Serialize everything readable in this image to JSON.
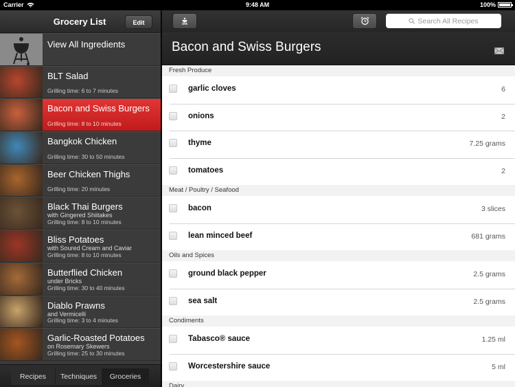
{
  "status_bar": {
    "carrier": "Carrier",
    "time": "9:48 AM",
    "battery": "100%",
    "battery_level": 1.0
  },
  "sidebar": {
    "title": "Grocery List",
    "edit_label": "Edit",
    "items": [
      {
        "title": "View All Ingredients",
        "subtitle": "",
        "time": "",
        "icon": "grill-icon",
        "color": "#8a8a8a"
      },
      {
        "title": "BLT Salad",
        "subtitle": "",
        "time": "Grilling time: 6 to 7 minutes",
        "color": "#b8452e"
      },
      {
        "title": "Bacon and Swiss Burgers",
        "subtitle": "",
        "time": "Grilling time: 8 to 10 minutes",
        "color": "#c9603d",
        "selected": true
      },
      {
        "title": "Bangkok Chicken",
        "subtitle": "",
        "time": "Grilling time: 30 to 50 minutes",
        "color": "#3f88b8"
      },
      {
        "title": "Beer Chicken Thighs",
        "subtitle": "",
        "time": "Grilling time: 20 minutes",
        "color": "#a9652c"
      },
      {
        "title": "Black Thai Burgers",
        "subtitle": "with Gingered Shiitakes",
        "time": "Grilling time: 8 to 10 minutes",
        "color": "#6b5236"
      },
      {
        "title": "Bliss Potatoes",
        "subtitle": "with Soured Cream and Caviar",
        "time": "Grilling time: 8 to 10 minutes",
        "color": "#9c3526"
      },
      {
        "title": "Butterflied Chicken",
        "subtitle": "under Bricks",
        "time": "Grilling time: 30 to 40 minutes",
        "color": "#a56a38"
      },
      {
        "title": "Diablo Prawns",
        "subtitle": "and Vermicelli",
        "time": "Grilling time: 3 to 4 minutes",
        "color": "#c8a36b"
      },
      {
        "title": "Garlic-Roasted Potatoes",
        "subtitle": "on Rosemary Skewers",
        "time": "Grilling time: 25 to 30 minutes",
        "color": "#a4561f"
      }
    ],
    "tabs": [
      {
        "label": "Recipes",
        "active": false
      },
      {
        "label": "Techniques",
        "active": false
      },
      {
        "label": "Groceries",
        "active": true
      }
    ]
  },
  "toolbar": {
    "grill_button_icon": "grill-icon",
    "timer_button_icon": "alarm-clock-icon",
    "search_placeholder": "Search All Recipes"
  },
  "recipe": {
    "title": "Bacon and Swiss Burgers",
    "sections": [
      {
        "name": "Fresh Produce",
        "items": [
          {
            "name": "garlic cloves",
            "qty": "6",
            "checked": false
          },
          {
            "name": "onions",
            "qty": "2",
            "checked": false
          },
          {
            "name": "thyme",
            "qty": "7.25 grams",
            "checked": false
          },
          {
            "name": "tomatoes",
            "qty": "2",
            "checked": false
          }
        ]
      },
      {
        "name": "Meat / Poultry / Seafood",
        "items": [
          {
            "name": "bacon",
            "qty": "3 slices",
            "checked": false
          },
          {
            "name": "lean minced beef",
            "qty": "681 grams",
            "checked": false
          }
        ]
      },
      {
        "name": "Oils and Spices",
        "items": [
          {
            "name": "ground black pepper",
            "qty": "2.5 grams",
            "checked": false
          },
          {
            "name": "sea salt",
            "qty": "2.5 grams",
            "checked": false
          }
        ]
      },
      {
        "name": "Condiments",
        "items": [
          {
            "name": "Tabasco® sauce",
            "qty": "1.25 ml",
            "checked": false
          },
          {
            "name": "Worcestershire sauce",
            "qty": "5 ml",
            "checked": false
          }
        ]
      },
      {
        "name": "Dairy",
        "items": []
      }
    ]
  },
  "colors": {
    "selected_row": "#d42a2a",
    "sidebar_bg": "#3b3b3b"
  }
}
